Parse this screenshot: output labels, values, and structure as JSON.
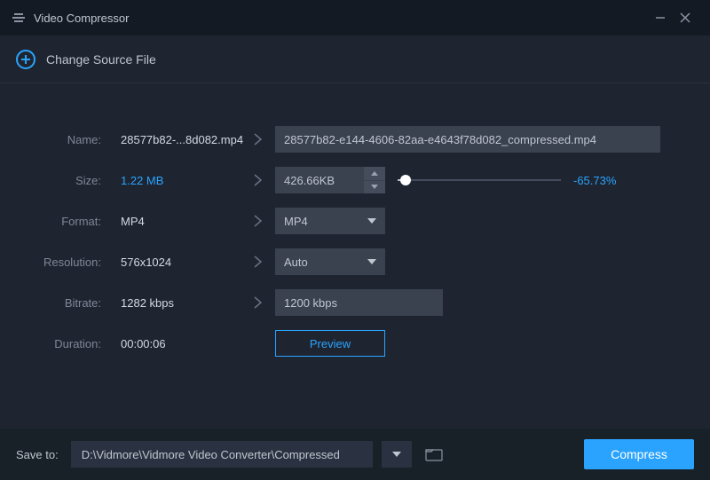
{
  "app": {
    "title": "Video Compressor"
  },
  "source": {
    "change_label": "Change Source File"
  },
  "labels": {
    "name": "Name:",
    "size": "Size:",
    "format": "Format:",
    "resolution": "Resolution:",
    "bitrate": "Bitrate:",
    "duration": "Duration:"
  },
  "original": {
    "name": "28577b82-...8d082.mp4",
    "size": "1.22 MB",
    "format": "MP4",
    "resolution": "576x1024",
    "bitrate": "1282 kbps",
    "duration": "00:00:06"
  },
  "output": {
    "name": "28577b82-e144-4606-82aa-e4643f78d082_compressed.mp4",
    "size": "426.66KB",
    "format": "MP4",
    "resolution": "Auto",
    "bitrate": "1200 kbps",
    "size_change_pct": "-65.73%"
  },
  "buttons": {
    "preview": "Preview",
    "compress": "Compress"
  },
  "footer": {
    "save_to_label": "Save to:",
    "path": "D:\\Vidmore\\Vidmore Video Converter\\Compressed"
  }
}
